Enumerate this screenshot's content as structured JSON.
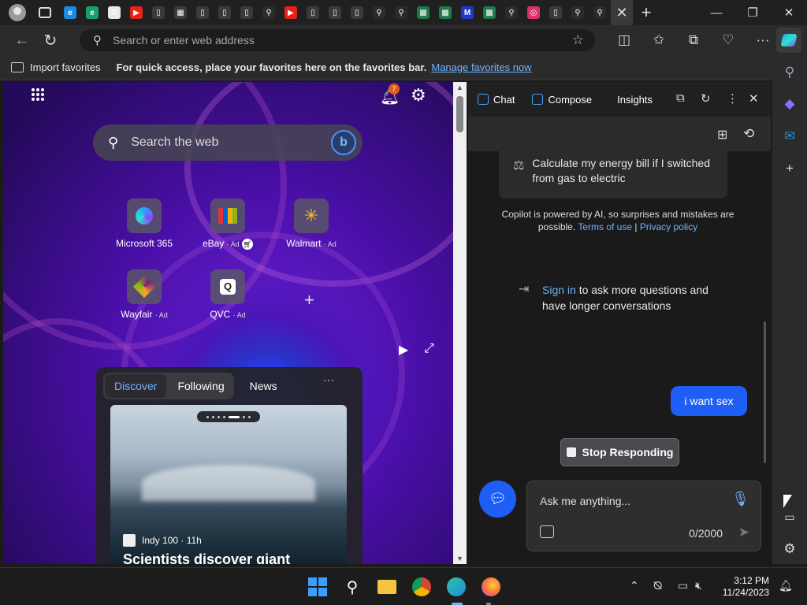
{
  "browser": {
    "address_placeholder": "Search or enter web address",
    "tab_favicons": [
      {
        "icon": "edge-icon",
        "color": "#1a8be0",
        "glyph": "e"
      },
      {
        "icon": "edge-icon",
        "color": "#19a06a",
        "glyph": "e"
      },
      {
        "icon": "chrome-icon",
        "color": "#e8e8e8",
        "glyph": "G"
      },
      {
        "icon": "youtube-icon",
        "color": "#e62117",
        "glyph": "▶"
      },
      {
        "icon": "page-icon",
        "color": "#3a3a3a",
        "glyph": "▯"
      },
      {
        "icon": "page-icon",
        "color": "#3a3a3a",
        "glyph": "▦"
      },
      {
        "icon": "page-icon",
        "color": "#3a3a3a",
        "glyph": "▯"
      },
      {
        "icon": "page-icon",
        "color": "#3a3a3a",
        "glyph": "▯"
      },
      {
        "icon": "page-icon",
        "color": "#3a3a3a",
        "glyph": "▯"
      },
      {
        "icon": "search-icon",
        "color": "#2b2b2b",
        "glyph": "⚲"
      },
      {
        "icon": "youtube-icon",
        "color": "#e62117",
        "glyph": "▶"
      },
      {
        "icon": "page-icon",
        "color": "#3a3a3a",
        "glyph": "▯"
      },
      {
        "icon": "page-icon",
        "color": "#3a3a3a",
        "glyph": "▯"
      },
      {
        "icon": "page-icon",
        "color": "#3a3a3a",
        "glyph": "▯"
      },
      {
        "icon": "search-icon",
        "color": "#2b2b2b",
        "glyph": "⚲"
      },
      {
        "icon": "search-icon",
        "color": "#2b2b2b",
        "glyph": "⚲"
      },
      {
        "icon": "sheet-icon",
        "color": "#1e7a4a",
        "glyph": "▩"
      },
      {
        "icon": "sheet-icon",
        "color": "#1e7a4a",
        "glyph": "▩"
      },
      {
        "icon": "mail-icon",
        "color": "#2438c8",
        "glyph": "M"
      },
      {
        "icon": "sheet-icon",
        "color": "#1e7a4a",
        "glyph": "▩"
      },
      {
        "icon": "search-icon",
        "color": "#2b2b2b",
        "glyph": "⚲"
      },
      {
        "icon": "instagram-icon",
        "color": "#e0306a",
        "glyph": "◎"
      },
      {
        "icon": "page-icon",
        "color": "#3a3a3a",
        "glyph": "▯"
      },
      {
        "icon": "search-icon",
        "color": "#2b2b2b",
        "glyph": "⚲"
      },
      {
        "icon": "search-icon",
        "color": "#2b2b2b",
        "glyph": "⚲"
      }
    ]
  },
  "favorites_bar": {
    "import_label": "Import favorites",
    "message": "For quick access, place your favorites here on the favorites bar.",
    "manage_link": "Manage favorites now"
  },
  "ntp": {
    "notification_count": "7",
    "search_placeholder": "Search the web",
    "tiles": [
      {
        "label": "Microsoft 365",
        "ad": ""
      },
      {
        "label": "eBay",
        "ad": "· Ad"
      },
      {
        "label": "Walmart",
        "ad": "· Ad"
      },
      {
        "label": "Wayfair",
        "ad": "· Ad"
      },
      {
        "label": "QVC",
        "ad": "· Ad"
      }
    ],
    "feed": {
      "tabs": [
        "Discover",
        "Following",
        "News"
      ],
      "more": "···",
      "card_source": "Indy 100 · 11h",
      "card_headline": "Scientists discover giant"
    }
  },
  "copilot": {
    "tabs": [
      "Chat",
      "Compose",
      "Insights"
    ],
    "suggestion": "Calculate my energy bill if I switched from gas to electric",
    "disclaimer_prefix": "Copilot is powered by AI, so surprises and mistakes are possible.",
    "terms_link": "Terms of use",
    "separator": "|",
    "privacy_link": "Privacy policy",
    "signin_link": "Sign in",
    "signin_rest": "to ask more questions and have longer conversations",
    "user_message": "i want  sex",
    "stop_label": "Stop Responding",
    "input_placeholder": "Ask me anything...",
    "char_count": "0/2000"
  },
  "taskbar": {
    "time": "3:12 PM",
    "date": "11/24/2023"
  },
  "colors": {
    "accent": "#1f5ef5",
    "link": "#6fb1ff"
  }
}
